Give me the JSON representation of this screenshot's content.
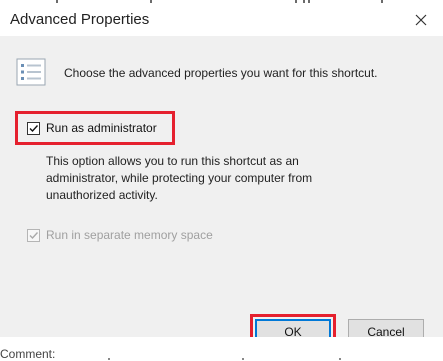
{
  "dialog": {
    "title": "Advanced Properties",
    "header_text": "Choose the advanced properties you want for this shortcut.",
    "options": {
      "run_as_admin": {
        "label": "Run as administrator",
        "checked": true,
        "description": "This option allows you to run this shortcut as an administrator, while protecting your computer from unauthorized activity."
      },
      "separate_memory": {
        "label": "Run in separate memory space",
        "checked": true,
        "disabled": true
      }
    },
    "buttons": {
      "ok": "OK",
      "cancel": "Cancel"
    }
  },
  "background_fragment": "Comment:",
  "icons": {
    "close": "close-icon",
    "properties": "properties-list-icon",
    "check": "checkmark-icon"
  },
  "colors": {
    "highlight": "#e5202e",
    "default_button_border": "#0078d7",
    "dialog_body": "#f0f0f0"
  }
}
